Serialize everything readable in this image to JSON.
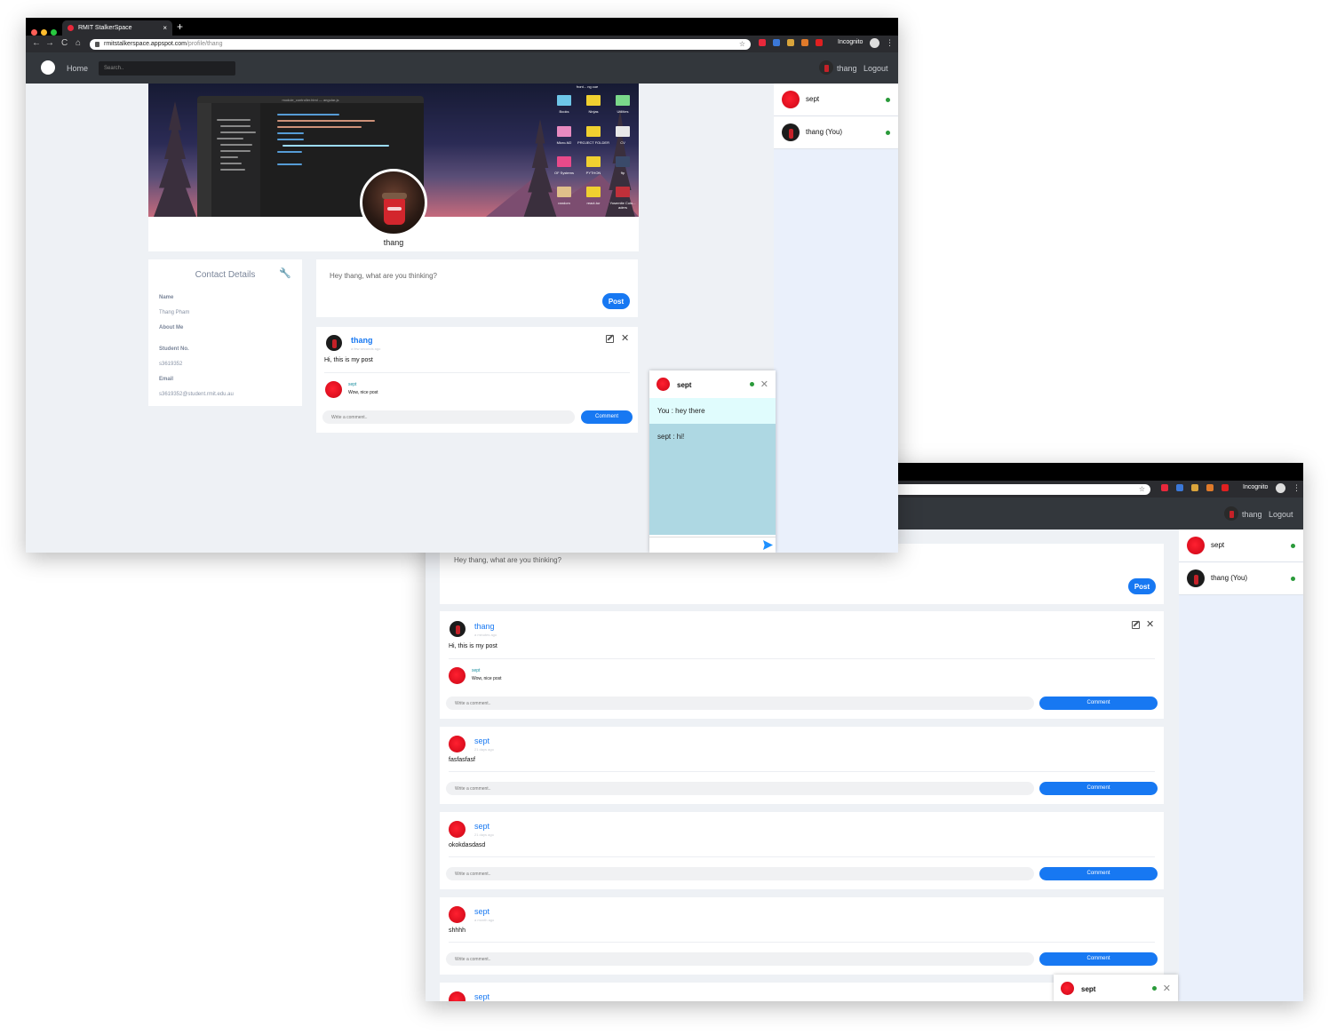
{
  "browser": {
    "tab_title": "RMIT StalkerSpace",
    "new_tab": "+",
    "tab_close": "×",
    "url_host": "rmitstalkerspace.appspot.com",
    "url_path": "/profile/thang",
    "incognito_label": "Incognito",
    "back": "←",
    "forward": "→",
    "reload": "C",
    "home": "⌂",
    "star": "☆",
    "menu": "⋮"
  },
  "navbar": {
    "home_label": "Home",
    "search_placeholder": "Search..",
    "username": "thang",
    "logout_label": "Logout"
  },
  "sidebar": {
    "users": [
      {
        "name": "sept",
        "online": true,
        "avatar": "red-dot"
      },
      {
        "name": "thang (You)",
        "online": true,
        "avatar": "coca-cola-cup"
      }
    ]
  },
  "cover": {
    "editor_title": "module_controller.html — angular-js",
    "desktop_folders": [
      "front... ng cue",
      "Books",
      "Ninjas",
      "Utilities",
      "Micro-M2",
      "PROJECT FOLDER",
      "CV",
      "OF Systems",
      "PYTHON",
      "ftp",
      "random",
      "react-tur",
      "Yosemite Colo... aders"
    ]
  },
  "profile": {
    "name": "thang"
  },
  "contact": {
    "title": "Contact Details",
    "name_label": "Name",
    "name_value": "Thang Pham",
    "about_label": "About Me",
    "about_value": "",
    "student_no_label": "Student No.",
    "student_no_value": "s3619352",
    "email_label": "Email",
    "email_value": "s3619352@student.rmit.edu.au"
  },
  "compose": {
    "placeholder": "Hey thang, what are you thinking?",
    "post_label": "Post"
  },
  "comment_input": {
    "placeholder": "Write a comment..",
    "button_label": "Comment"
  },
  "posts": [
    {
      "author": "thang",
      "time": "a few seconds ago",
      "time_alt": "a minutes ago",
      "text": "Hi, this is my post",
      "comments": [
        {
          "author": "sept",
          "text": "Wow, nice post"
        }
      ]
    },
    {
      "author": "sept",
      "time": "21 days ago",
      "text": "fasfasfasf",
      "comments": []
    },
    {
      "author": "sept",
      "time": "21 days ago",
      "text": "okokdasdasd",
      "comments": []
    },
    {
      "author": "sept",
      "time": "a month ago",
      "text": "shhhh",
      "comments": []
    },
    {
      "author": "sept",
      "time": "",
      "text": "",
      "comments": []
    }
  ],
  "chat": {
    "contact": "sept",
    "messages": [
      {
        "sender": "You",
        "text": "You : hey there"
      },
      {
        "sender": "sept",
        "text": "sept : hi!"
      }
    ],
    "close": "✕"
  },
  "colors": {
    "accent": "#1778f2",
    "navbar": "#33373c",
    "online": "#2a9a3a",
    "chat_you_bg": "#e0fcfd",
    "chat_other_bg": "#aed8e3",
    "sidebar_bg": "#eaf0fb"
  },
  "icons": [
    "search-icon",
    "wrench-icon",
    "edit-icon",
    "close-icon",
    "send-icon",
    "lock-icon",
    "star-icon",
    "incognito-icon"
  ]
}
